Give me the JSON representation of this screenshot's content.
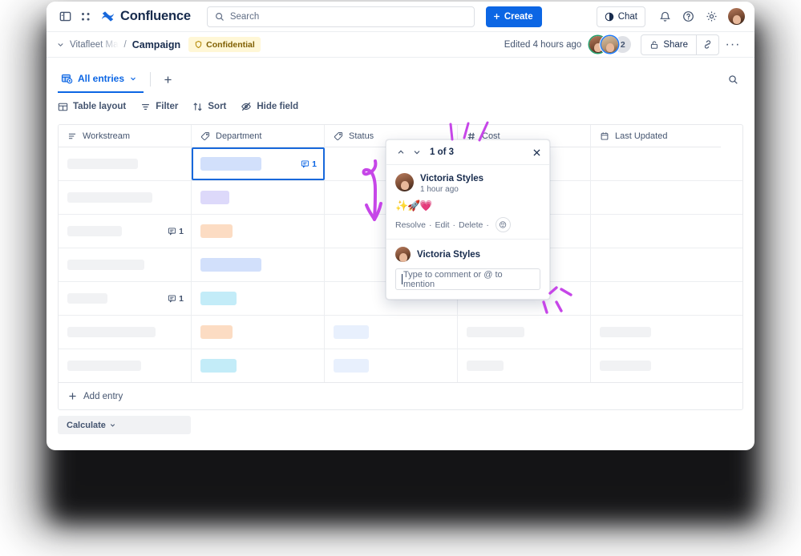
{
  "topnav": {
    "sidebar_toggle_icon": "sidebar-toggle-icon",
    "apps_icon": "app-switcher-icon",
    "brand": "Confluence",
    "search_placeholder": "Search",
    "search_icon": "search-icon",
    "create_label": "Create",
    "chat_label": "Chat",
    "chat_icon": "chat-icon",
    "notifications_icon": "bell-icon",
    "help_icon": "question-circle-icon",
    "settings_icon": "gear-icon",
    "profile_icon": "user-avatar"
  },
  "breadcrumb": {
    "collapse_icon": "chevron-down-icon",
    "space": "Vitafleet Ma",
    "separator": "/",
    "current": "Campaign",
    "classification": "Confidential",
    "classification_icon": "shield-icon",
    "edited": "Edited 4 hours ago",
    "collaborator_count": "2",
    "share_label": "Share",
    "share_icon": "lock-open-icon",
    "link_icon": "link-icon",
    "more_icon": "more-horizontal-icon"
  },
  "view": {
    "tab_label": "All entries",
    "tab_icon": "database-view-icon",
    "tab_chevron_icon": "chevron-down-icon",
    "add_view_icon": "plus-icon",
    "search_icon": "search-icon",
    "tools": [
      {
        "label": "Table layout",
        "icon": "table-icon"
      },
      {
        "label": "Filter",
        "icon": "filter-icon"
      },
      {
        "label": "Sort",
        "icon": "sort-icon"
      },
      {
        "label": "Hide field",
        "icon": "eye-off-icon"
      }
    ]
  },
  "table": {
    "columns": [
      {
        "label": "Workstream",
        "icon": "text-lines-icon"
      },
      {
        "label": "Department",
        "icon": "tag-icon"
      },
      {
        "label": "Status",
        "icon": "tag-icon"
      },
      {
        "label": "Cost",
        "icon": "number-hash-icon"
      },
      {
        "label": "Last Updated",
        "icon": "calendar-icon"
      }
    ],
    "rows": [
      {
        "workstream_w": 88,
        "workstream_comments": "",
        "dept_w": 76,
        "dept_color": "#d2e0fb",
        "status_w": 0,
        "cost_w": 0,
        "updated_w": 0,
        "selected": true
      },
      {
        "workstream_w": 106,
        "workstream_comments": "",
        "dept_w": 36,
        "dept_color": "#ddd9fa",
        "status_w": 0,
        "cost_w": 0,
        "updated_w": 0,
        "selected": false
      },
      {
        "workstream_w": 68,
        "workstream_comments": "1",
        "dept_w": 40,
        "dept_color": "#fcdcc3",
        "status_w": 0,
        "cost_w": 0,
        "updated_w": 0,
        "selected": false
      },
      {
        "workstream_w": 96,
        "workstream_comments": "",
        "dept_w": 76,
        "dept_color": "#d2e0fb",
        "status_w": 0,
        "cost_w": 0,
        "updated_w": 0,
        "selected": false
      },
      {
        "workstream_w": 50,
        "workstream_comments": "1",
        "dept_w": 45,
        "dept_color": "#c3ecf8",
        "status_w": 0,
        "cost_w": 0,
        "updated_w": 0,
        "selected": false
      },
      {
        "workstream_w": 110,
        "workstream_comments": "",
        "dept_w": 40,
        "dept_color": "#fcdcc3",
        "status_w": 44,
        "cost_w": 72,
        "updated_w": 64,
        "selected": false
      },
      {
        "workstream_w": 92,
        "workstream_comments": "",
        "dept_w": 45,
        "dept_color": "#c3ecf8",
        "status_w": 44,
        "cost_w": 46,
        "updated_w": 64,
        "selected": false
      }
    ],
    "comment_icon": "comment-bubble-icon",
    "status_pill_color": "#e8f0fd",
    "skeleton_color": "#f1f2f4",
    "add_entry_label": "Add entry",
    "add_entry_icon": "plus-icon",
    "calculate_label": "Calculate",
    "calculate_chevron_icon": "chevron-down-icon"
  },
  "comment_popup": {
    "prev_icon": "chevron-up-icon",
    "next_icon": "chevron-down-icon",
    "counter": "1 of 3",
    "close_icon": "close-icon",
    "author": "Victoria Styles",
    "timestamp": "1 hour ago",
    "body": "✨🚀💗",
    "actions": [
      "Resolve",
      "Edit",
      "Delete"
    ],
    "action_separator": "·",
    "emoji_icon": "add-reaction-icon",
    "reply_author": "Victoria Styles",
    "reply_placeholder": "Type to comment or @ to mention"
  },
  "colors": {
    "accent": "#0c66e4",
    "selection": "#1868db",
    "annotation": "#c646e8",
    "text": "#172b4d",
    "subtle_text": "#44546f"
  }
}
